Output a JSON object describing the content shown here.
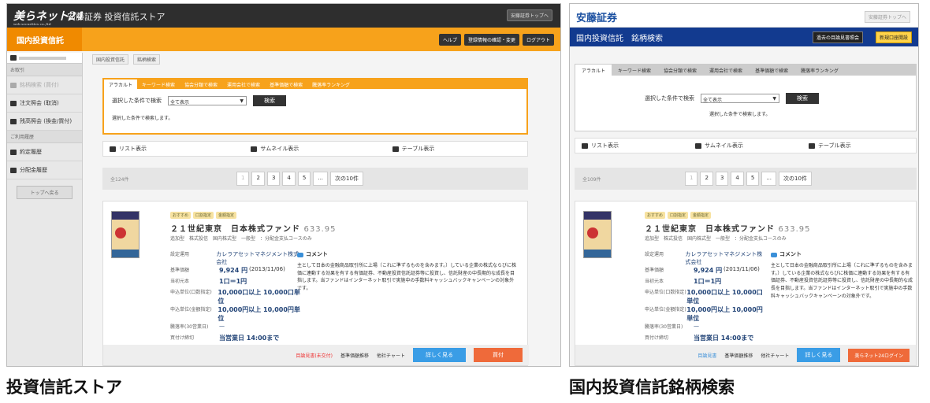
{
  "left": {
    "logo": "美らネット24",
    "logo_sub": "web securities co.,ltd",
    "app_title": "安藤証券 投資信託ストア",
    "top_link": "安藤証券トップへ",
    "section": "国内投資信託",
    "header_buttons": [
      "ヘルプ",
      "登録情報の確認・変更",
      "ログアウト"
    ],
    "sidebar": {
      "group1": "お取引",
      "items1": [
        "銘柄検索 (買付)",
        "注文照会 (取消)",
        "残高照会 (換金/買付)"
      ],
      "group2": "ご利用履歴",
      "items2": [
        "約定履歴",
        "分配金履歴"
      ],
      "back": "トップへ戻る"
    },
    "breadcrumb": [
      "国内投資信託",
      "銘柄検索"
    ],
    "search": {
      "tabs": [
        "アラカルト",
        "キーワード検索",
        "協会分類で検索",
        "運用会社で検索",
        "基準価額で検索",
        "騰落率ランキング"
      ],
      "label": "選択した条件で検索",
      "select": "全て表示",
      "button": "検索",
      "note": "選択した条件で検索します。"
    },
    "views": [
      "リスト表示",
      "サムネイル表示",
      "テーブル表示"
    ],
    "pager": {
      "count": "全124件",
      "pages": [
        "1",
        "2",
        "3",
        "4",
        "5",
        "...",
        "次の10件"
      ]
    },
    "card": {
      "tags": [
        "おすすめ",
        "口割指定",
        "金額指定"
      ],
      "name": "２１世紀東京　日本株式ファンド",
      "nav": "633.95",
      "sub": "追加型　株式投信　国内株式型　一般型　：分配金支払コースのみ",
      "details": [
        {
          "k": "設定運用",
          "v": "カレラアセットマネジメント株式会社",
          "big": false
        },
        {
          "k": "基準価額",
          "v": "9,924 円",
          "extra": "(2013/11/06)",
          "big": true
        },
        {
          "k": "当初元本",
          "v": "1口＝1円",
          "big": true
        },
        {
          "k": "申込単位(口数指定)",
          "v": "10,000口以上 10,000口単位",
          "big": true
        },
        {
          "k": "申込単位(金額指定)",
          "v": "10,000円以上 10,000円単位",
          "big": true
        },
        {
          "k": "騰落率(30営業日)",
          "v": "—",
          "big": false
        },
        {
          "k": "買付け締切",
          "v": "当営業日 14:00まで",
          "big": true
        }
      ],
      "comment_title": "コメント",
      "comment": "主として日本の金融商品取引所に上場（これに準ずるものを含みます。）している企業の株式ならびに株価に連動する効果を有する有価証券、不動産投資信託証券等に投資し、信託財産の中長期的な成長を目指します。当ファンドはインターネット取引で実施中の手数料キャッシュバックキャンペーンの対象外です。",
      "footer": [
        "目論見書(未交付)",
        "基準価額推移",
        "他社チャート"
      ],
      "detail_btn": "詳しく見る",
      "buy_btn": "買付"
    }
  },
  "right": {
    "logo": "安藤証券",
    "top_link": "安藤証券トップへ",
    "bar_title": "国内投資信託　銘柄検索",
    "bar_btn1": "過去の目論見書照会",
    "bar_btn2": "新規口座開設",
    "search": {
      "tabs": [
        "アラカルト",
        "キーワード検索",
        "協会分類で検索",
        "運用会社で検索",
        "基準価額で検索",
        "騰落率ランキング"
      ],
      "label": "選択した条件で検索",
      "select": "全て表示",
      "button": "検索",
      "note": "選択した条件で検索します。"
    },
    "views": [
      "リスト表示",
      "サムネイル表示",
      "テーブル表示"
    ],
    "pager": {
      "count": "全109件",
      "pages": [
        "1",
        "2",
        "3",
        "4",
        "5",
        "...",
        "次の10件"
      ]
    },
    "card": {
      "tags": [
        "おすすめ",
        "口割指定",
        "金額指定"
      ],
      "name": "２１世紀東京　日本株式ファンド",
      "nav": "633.95",
      "sub": "追加型　株式投信　国内株式型　一般型　：分配金支払コースのみ",
      "details": [
        {
          "k": "設定運用",
          "v": "カレラアセットマネジメント株式会社",
          "big": false
        },
        {
          "k": "基準価額",
          "v": "9,924 円",
          "extra": "(2013/11/06)",
          "big": true
        },
        {
          "k": "当初元本",
          "v": "1口＝1円",
          "big": true
        },
        {
          "k": "申込単位(口数指定)",
          "v": "10,000口以上 10,000口単位",
          "big": true
        },
        {
          "k": "申込単位(金額指定)",
          "v": "10,000円以上 10,000円単位",
          "big": true
        },
        {
          "k": "騰落率(30営業日)",
          "v": "—",
          "big": false
        },
        {
          "k": "買付け締切",
          "v": "当営業日 14:00まで",
          "big": true
        }
      ],
      "comment_title": "コメント",
      "comment": "主として日本の金融商品取引所に上場（これに準ずるものを含みます。）している企業の株式ならびに株価に連動する効果を有する有価証券、不動産投資信託証券等に投資し、信託財産の中長期的な成長を目指します。当ファンドはインターネット取引で実施中の手数料キャッシュバックキャンペーンの対象外です。",
      "footer": [
        "目論見書",
        "基準価額推移",
        "他社チャート"
      ],
      "detail_btn": "詳しく見る",
      "login_btn": "美らネット24ログイン"
    }
  },
  "captions": {
    "left": "投資信託ストア",
    "right": "国内投資信託銘柄検索"
  }
}
